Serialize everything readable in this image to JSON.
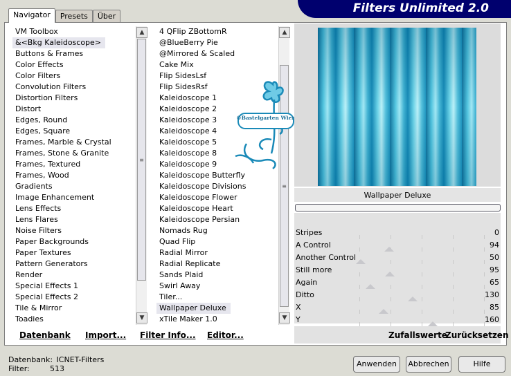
{
  "window": {
    "title": "Filters Unlimited 2.0"
  },
  "tabs": [
    {
      "label": "Navigator",
      "active": true
    },
    {
      "label": "Presets",
      "active": false
    },
    {
      "label": "Über",
      "active": false
    }
  ],
  "categories": {
    "items": [
      "VM Toolbox",
      "&<Bkg Kaleidoscope>",
      "Buttons & Frames",
      "Color Effects",
      "Color Filters",
      "Convolution Filters",
      "Distortion Filters",
      "Distort",
      "Edges, Round",
      "Edges, Square",
      "Frames, Marble & Crystal",
      "Frames, Stone & Granite",
      "Frames, Textured",
      "Frames, Wood",
      "Gradients",
      "Image Enhancement",
      "Lens Effects",
      "Lens Flares",
      "Noise Filters",
      "Paper Backgrounds",
      "Paper Textures",
      "Pattern Generators",
      "Render",
      "Special Effects 1",
      "Special Effects 2",
      "Tile & Mirror",
      "Toadies"
    ],
    "selected": "&<Bkg Kaleidoscope>"
  },
  "filters": {
    "items": [
      "4 QFlip ZBottomR",
      "@BlueBerry Pie",
      "@Mirrored & Scaled",
      "Cake Mix",
      "Flip SidesLsf",
      "Flip SidesRsf",
      "Kaleidoscope 1",
      "Kaleidoscope 2",
      "Kaleidoscope 3",
      "Kaleidoscope 4",
      "Kaleidoscope 5",
      "Kaleidoscope 8",
      "Kaleidoscope 9",
      "Kaleidoscope Butterfly",
      "Kaleidoscope Divisions",
      "Kaleidoscope Flower",
      "Kaleidoscope Heart",
      "Kaleidoscope Persian",
      "Nomads Rug",
      "Quad Flip",
      "Radial Mirror",
      "Radial Replicate",
      "Sands Plaid",
      "Swirl Away",
      "Tiler...",
      "Wallpaper Deluxe",
      "xTile Maker 1.0"
    ],
    "selected": "Wallpaper Deluxe"
  },
  "panel_buttons": {
    "datenbank": "Datenbank",
    "import": "Import...",
    "filter_info": "Filter Info...",
    "editor": "Editor..."
  },
  "preview": {
    "filter_name": "Wallpaper Deluxe",
    "watermark": "©Bastelgarten Wien"
  },
  "sliders": [
    {
      "label": "Stripes",
      "value": 0,
      "max": 255
    },
    {
      "label": "A Control",
      "value": 94,
      "max": 255
    },
    {
      "label": "Another Control",
      "value": 50,
      "max": 255
    },
    {
      "label": "Still more",
      "value": 95,
      "max": 255
    },
    {
      "label": "Again",
      "value": 65,
      "max": 255
    },
    {
      "label": "Ditto",
      "value": 130,
      "max": 255
    },
    {
      "label": "X",
      "value": 85,
      "max": 255
    },
    {
      "label": "Y",
      "value": 160,
      "max": 255
    }
  ],
  "right_buttons": {
    "random": "Zufallswerte",
    "reset": "Zurücksetzen"
  },
  "status": {
    "db_label": "Datenbank:",
    "db_value": "ICNET-Filters",
    "filter_label": "Filter:",
    "filter_count": "513"
  },
  "dialog_buttons": {
    "apply": "Anwenden",
    "cancel": "Abbrechen",
    "help": "Hilfe"
  },
  "icons": {
    "scroll_up": "▲",
    "scroll_down": "▼",
    "grip": "≡"
  }
}
